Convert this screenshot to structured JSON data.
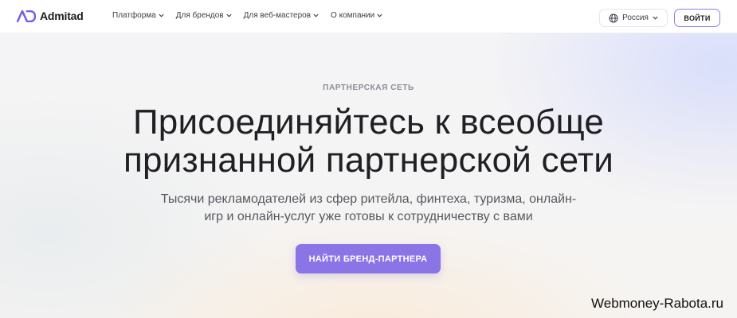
{
  "header": {
    "logo_text": "Admitad",
    "nav": [
      {
        "label": "Платформа"
      },
      {
        "label": "Для брендов"
      },
      {
        "label": "Для веб-мастеров"
      },
      {
        "label": "О компании"
      }
    ],
    "region_label": "Россия",
    "login_label": "ВОЙТИ"
  },
  "hero": {
    "eyebrow": "ПАРТНЕРСКАЯ СЕТЬ",
    "title_line1": "Присоединяйтесь к всеобще",
    "title_line2": "признанной партнерской сети",
    "subtitle_line1": "Тысячи рекламодателей из сфер ритейла, финтеха, туризма, онлайн-",
    "subtitle_line2": "игр и онлайн-услуг уже готовы к сотрудничеству с вами",
    "cta_label": "НАЙТИ БРЕНД-ПАРТНЕРА"
  },
  "watermark": "Webmoney-Rabota.ru",
  "colors": {
    "accent": "#8b74e6",
    "login_border": "#8d7fe4",
    "text_dark": "#1f1f24"
  }
}
